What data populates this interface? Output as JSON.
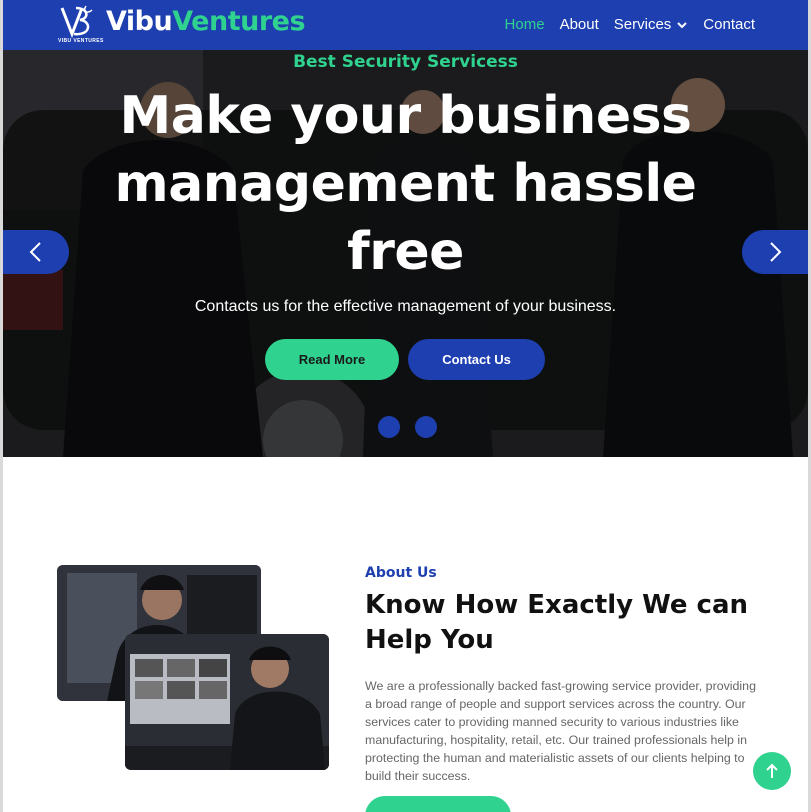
{
  "brand": {
    "name_part1": "Vibu",
    "name_part2": "Ventures",
    "tagline": "VIBU VENTURES",
    "logo_icon": "vb-monogram-icon",
    "primary_color": "#1e3fb0",
    "accent_color": "#2fd28e"
  },
  "nav": {
    "items": [
      {
        "label": "Home",
        "active": true
      },
      {
        "label": "About",
        "active": false
      },
      {
        "label": "Services",
        "active": false,
        "icon": "chevron-down-icon"
      },
      {
        "label": "Contact",
        "active": false
      }
    ]
  },
  "hero": {
    "subtitle": "Best Security Servicess",
    "title": "Make your business management hassle free",
    "description": "Contacts us for the effective management of your business.",
    "primary_button": "Read More",
    "secondary_button": "Contact Us",
    "prev_icon": "chevron-left-icon",
    "next_icon": "chevron-right-icon",
    "slide_count": 2
  },
  "about": {
    "label": "About Us",
    "title": "Know How Exactly We can Help You",
    "body": "We are a professionally backed fast-growing service provider, providing a broad range of people and support services across the country. Our services cater to providing manned security to various industries like manufacturing, hospitality, retail, etc. Our trained professionals help in protecting the human and materialistic assets of our clients helping to build their success."
  },
  "scroll_top_icon": "arrow-up-icon"
}
